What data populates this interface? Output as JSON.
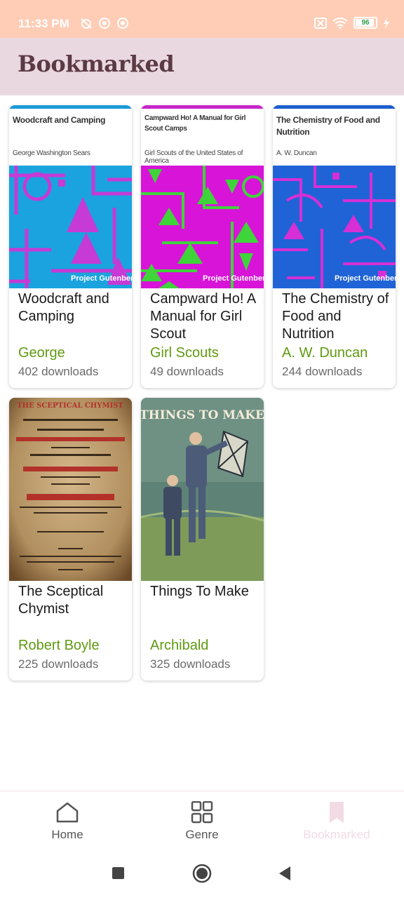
{
  "status_bar": {
    "time": "11:33 PM",
    "battery": "96"
  },
  "app_bar": {
    "title": "Bookmarked"
  },
  "books": [
    {
      "cover_title": "Woodcraft and Camping",
      "cover_author": "George Washington Sears",
      "cover_publisher": "Project Gutenberg",
      "title": "Woodcraft and Camping",
      "author": "George",
      "downloads": "402 downloads"
    },
    {
      "cover_title": "Campward Ho! A Manual for Girl Scout Camps",
      "cover_author": "Girl Scouts of the United States of America",
      "cover_publisher": "Project Gutenberg",
      "title": "Campward Ho! A Manual for Girl Scout",
      "author": "Girl Scouts",
      "downloads": "49 downloads"
    },
    {
      "cover_title": "The Chemistry of Food and Nutrition",
      "cover_author": "A. W. Duncan",
      "cover_publisher": "Project Gutenberg",
      "title": "The Chemistry of Food and Nutrition",
      "author": "A. W. Duncan",
      "downloads": "244 downloads"
    },
    {
      "cover_title": "THE SCEPTICAL CHYMIST",
      "title": "The Sceptical Chymist",
      "author": "Robert Boyle",
      "downloads": "225 downloads"
    },
    {
      "cover_title": "THINGS TO MAKE",
      "title": "Things To Make",
      "author": "Archibald",
      "downloads": "325 downloads"
    }
  ],
  "bottom_nav": [
    {
      "label": "Home",
      "icon": "home-icon"
    },
    {
      "label": "Genre",
      "icon": "grid-icon"
    },
    {
      "label": "Bookmarked",
      "icon": "bookmark-icon",
      "active": true
    }
  ],
  "colors": {
    "status_bar": "#ffcdb6",
    "app_bar": "#ead8e1",
    "author_green": "#5f9a11",
    "active_nav": "#f2dbe5"
  }
}
